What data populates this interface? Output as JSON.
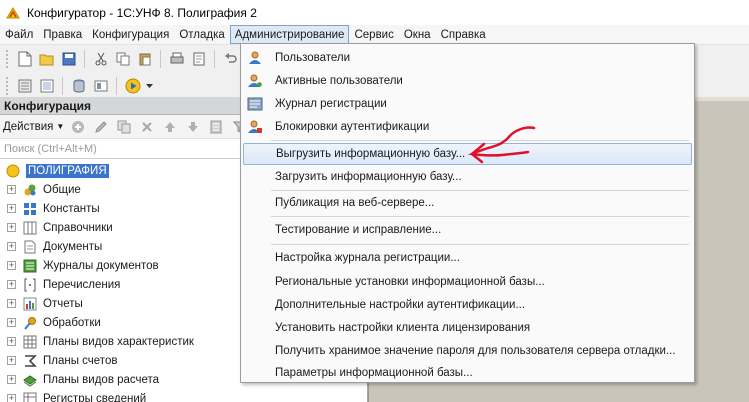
{
  "window": {
    "title": "Конфигуратор - 1С:УНФ 8. Полиграфия 2",
    "app_icon": "1c-app-icon"
  },
  "menubar": [
    {
      "label": "Файл"
    },
    {
      "label": "Правка"
    },
    {
      "label": "Конфигурация"
    },
    {
      "label": "Отладка"
    },
    {
      "label": "Администрирование",
      "active": true
    },
    {
      "label": "Сервис"
    },
    {
      "label": "Окна"
    },
    {
      "label": "Справка"
    }
  ],
  "panel": {
    "title": "Конфигурация",
    "actions_label": "Действия",
    "search_placeholder": "Поиск (Ctrl+Alt+M)"
  },
  "tree": [
    {
      "label": "ПОЛИГРАФИЯ",
      "icon": "config-root-icon",
      "root": true
    },
    {
      "label": "Общие",
      "icon": "common-icon"
    },
    {
      "label": "Константы",
      "icon": "constants-icon"
    },
    {
      "label": "Справочники",
      "icon": "catalogs-icon"
    },
    {
      "label": "Документы",
      "icon": "documents-icon"
    },
    {
      "label": "Журналы документов",
      "icon": "document-journals-icon"
    },
    {
      "label": "Перечисления",
      "icon": "enums-icon"
    },
    {
      "label": "Отчеты",
      "icon": "reports-icon"
    },
    {
      "label": "Обработки",
      "icon": "dataprocessors-icon"
    },
    {
      "label": "Планы видов характеристик",
      "icon": "chart-of-characteristic-types-icon"
    },
    {
      "label": "Планы счетов",
      "icon": "chart-of-accounts-icon"
    },
    {
      "label": "Планы видов расчета",
      "icon": "chart-of-calculation-types-icon"
    },
    {
      "label": "Регистры сведений",
      "icon": "information-registers-icon"
    }
  ],
  "dropdown": {
    "items": [
      {
        "label": "Пользователи",
        "icon": "user-icon"
      },
      {
        "label": "Активные пользователи",
        "icon": "active-users-icon"
      },
      {
        "label": "Журнал регистрации",
        "icon": "event-log-icon"
      },
      {
        "label": "Блокировки аутентификации",
        "icon": "auth-lock-icon"
      },
      {
        "label": "Выгрузить информационную базу...",
        "highlighted": true
      },
      {
        "label": "Загрузить информационную базу..."
      },
      {
        "label": "Публикация на веб-сервере..."
      },
      {
        "label": "Тестирование и исправление..."
      },
      {
        "label": "Настройка журнала регистрации..."
      },
      {
        "label": "Региональные установки информационной базы..."
      },
      {
        "label": "Дополнительные настройки аутентификации..."
      },
      {
        "label": "Установить настройки клиента лицензирования"
      },
      {
        "label": "Получить хранимое значение пароля для пользователя сервера отладки..."
      },
      {
        "label": "Параметры информационной базы..."
      }
    ]
  },
  "colors": {
    "menu_active_bg": "#dfe9f6",
    "selection_bg": "#3b74c9",
    "annotation_red": "#e0102a"
  }
}
